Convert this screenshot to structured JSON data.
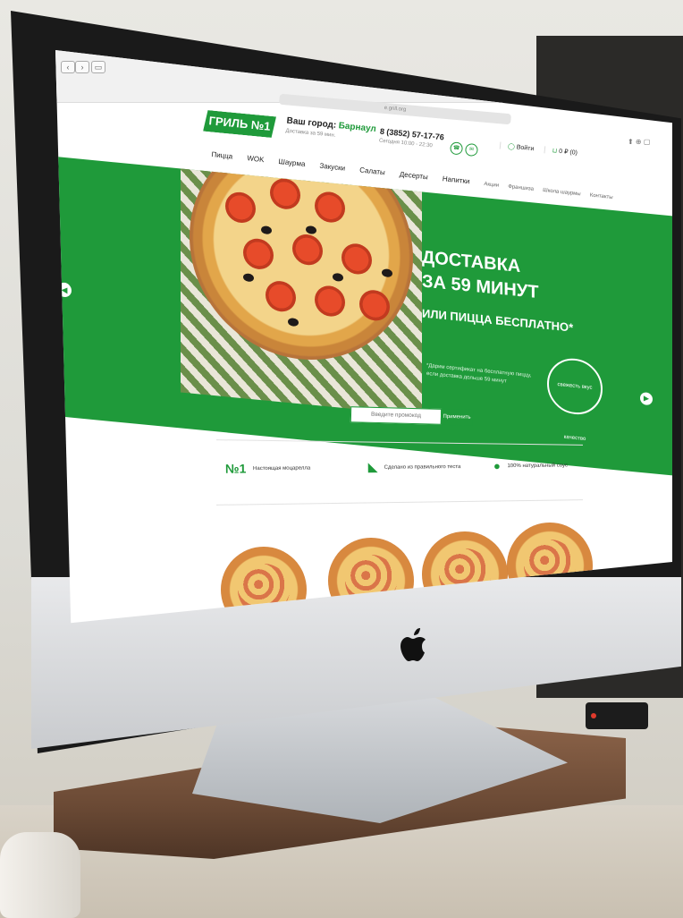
{
  "site": {
    "url": "e.grill.org",
    "logo_text": "ГРИЛЬ №1",
    "city_label": "Ваш город:",
    "city_value": "Барнаул",
    "delivery_note": "Доставка за 59 мин.",
    "phone": "8 (3852) 57-17-76",
    "hours": "Сегодня 10:00 - 22:30",
    "login_label": "Войти",
    "cart_label": "0 ₽ (0)"
  },
  "menu": {
    "main": [
      "Пицца",
      "WOK",
      "Шаурма",
      "Закуски",
      "Салаты",
      "Десерты",
      "Напитки"
    ],
    "secondary": [
      "Акции",
      "Франшиза",
      "Школа шаурмы",
      "Контакты"
    ]
  },
  "hero": {
    "line1": "ДОСТАВКА",
    "line2": "ЗА 59 МИНУТ",
    "line3": "ИЛИ ПИЦЦА БЕСПЛАТНО*",
    "note": "*Дарим сертификат на бесплатную пиццу, если доставка дольше 59 минут",
    "seal_text": "свежесть вкус качество",
    "accent_color": "#1f9a3a"
  },
  "promo": {
    "placeholder": "Введите промокод",
    "button_label": "Применить"
  },
  "features": [
    {
      "icon": "no1-icon",
      "label": "Настоящая моцарелла"
    },
    {
      "icon": "pizza-slice-icon",
      "label": "Сделано из правильного теста"
    },
    {
      "icon": "tomato-icon",
      "label": "100% натуральный соус"
    }
  ]
}
